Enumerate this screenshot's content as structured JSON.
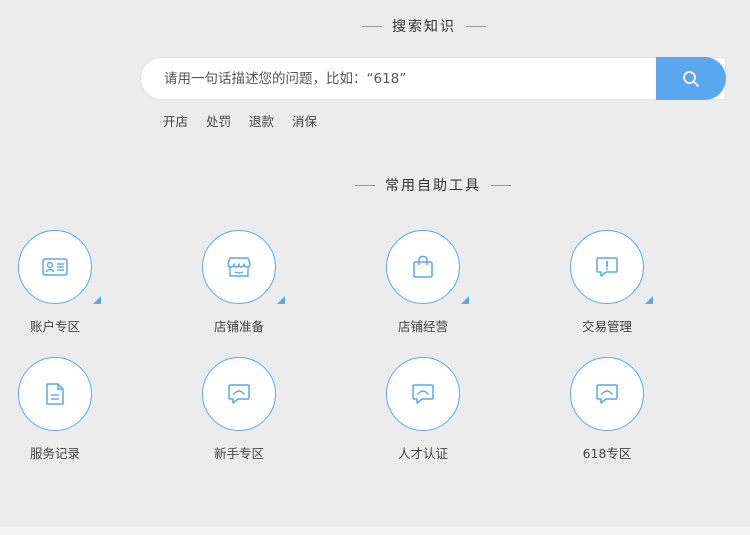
{
  "search_section": {
    "title": "搜索知识",
    "placeholder": "请用一句话描述您的问题，比如：“618”",
    "hot_tags": [
      "开店",
      "处罚",
      "退款",
      "消保"
    ]
  },
  "tools_section": {
    "title": "常用自助工具",
    "tools": [
      {
        "label": "账户专区",
        "icon": "id-card-icon"
      },
      {
        "label": "店铺准备",
        "icon": "store-icon"
      },
      {
        "label": "店铺经营",
        "icon": "shopping-bag-icon"
      },
      {
        "label": "交易管理",
        "icon": "alert-chat-icon"
      },
      {
        "label": "服务记录",
        "icon": "document-icon"
      },
      {
        "label": "新手专区",
        "icon": "chat-icon"
      },
      {
        "label": "人才认证",
        "icon": "chat-icon"
      },
      {
        "label": "618专区",
        "icon": "chat-icon"
      }
    ]
  },
  "colors": {
    "accent": "#5aa7f0",
    "background": "#ececec"
  }
}
